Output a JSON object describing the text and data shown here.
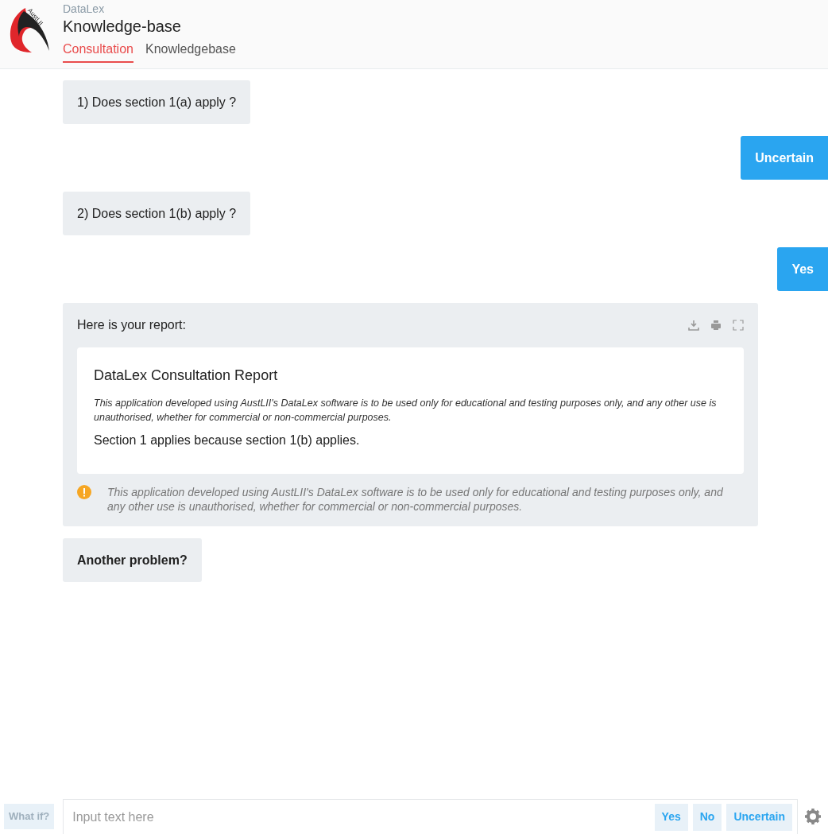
{
  "header": {
    "logo_text": "AustLII",
    "subtitle": "DataLex",
    "title": "Knowledge-base",
    "tabs": [
      {
        "label": "Consultation",
        "selected": true
      },
      {
        "label": "Knowledgebase",
        "selected": false
      }
    ]
  },
  "messages": [
    {
      "kind": "question",
      "text": "1) Does section 1(a) apply ?"
    },
    {
      "kind": "answer",
      "text": "Uncertain"
    },
    {
      "kind": "question",
      "text": "2) Does section 1(b) apply ?"
    },
    {
      "kind": "answer",
      "text": "Yes"
    },
    {
      "kind": "report",
      "text": "Here is your report:",
      "report_title": "DataLex Consultation Report",
      "disclaimer": "This application developed using AustLII's DataLex software is to be used only for educational and testing purposes only, and any other use is unauthorised, whether for commercial or non-commercial purposes.",
      "conclusion": "Section 1 applies because section 1(b) applies.",
      "notice": "This application developed using AustLII's DataLex software is to be used only for educational and testing purposes only, and any other use is unauthorised, whether for commercial or non-commercial purposes."
    },
    {
      "kind": "prompt",
      "text": "Another problem?"
    }
  ],
  "input_bar": {
    "what_if": "What if?",
    "placeholder": "Input text here",
    "quick_replies": [
      "Yes",
      "No",
      "Uncertain"
    ]
  }
}
